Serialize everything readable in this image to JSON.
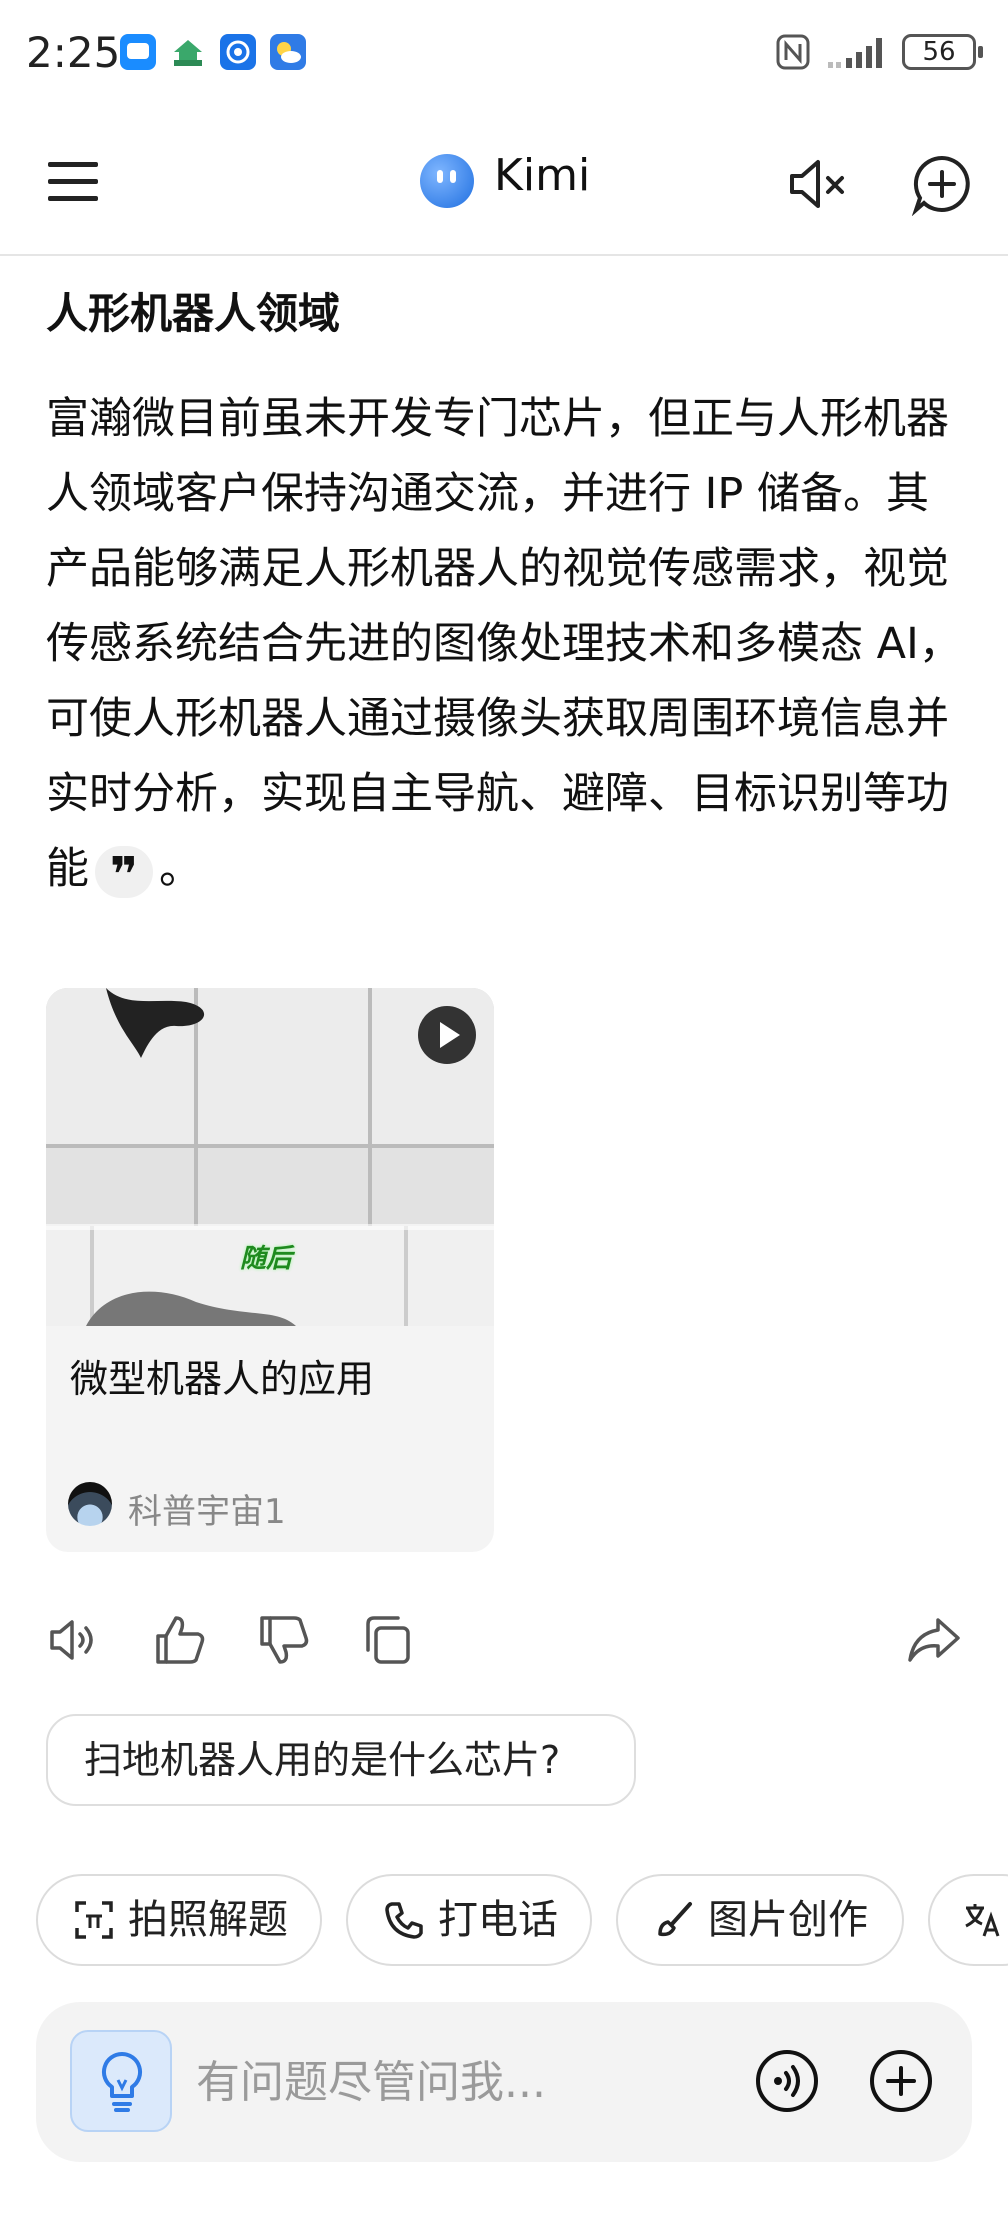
{
  "status_bar": {
    "time": "2:25",
    "battery": "56"
  },
  "header": {
    "title": "Kimi"
  },
  "content": {
    "section_title": "人形机器人领域",
    "paragraph": "富瀚微目前虽未开发专门芯片，但正与人形机器人领域客户保持沟通交流，并进行 IP 储备。其产品能够满足人形机器人的视觉传感需求，视觉传感系统结合先进的图像处理技术和多模态 AI，可使人形机器人通过摄像头获取周围环境信息并实时分析，实现自主导航、避障、目标识别等功能",
    "quote_mark": "❞",
    "paragraph_end": "。"
  },
  "video_card": {
    "thumb_caption": "随后",
    "title": "微型机器人的应用",
    "channel": "科普宇宙1"
  },
  "suggestion": "扫地机器人用的是什么芯片?",
  "quick_actions": [
    {
      "label": "拍照解题",
      "icon": "camera-scan-icon"
    },
    {
      "label": "打电话",
      "icon": "phone-icon"
    },
    {
      "label": "图片创作",
      "icon": "brush-icon"
    },
    {
      "label": "",
      "icon": "translate-icon"
    }
  ],
  "input": {
    "placeholder": "有问题尽管问我..."
  }
}
